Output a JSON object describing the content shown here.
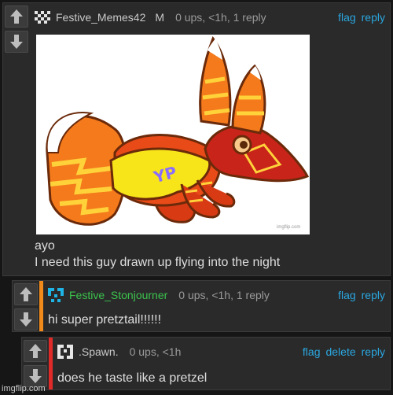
{
  "comments": [
    {
      "username": "Festive_Memes42",
      "mod_badge": "M",
      "meta": "0 ups, <1h, 1 reply",
      "actions": [
        "flag",
        "reply"
      ],
      "text_lines": [
        "ayo",
        "I need this guy drawn up flying into the night"
      ],
      "avatar_icon": "pixel-avatar-icon",
      "image_watermark": "imgflip.com"
    },
    {
      "username": "Festive_Stonjourner",
      "username_color": "#3bc24d",
      "accent_color": "#f08a1a",
      "meta": "0 ups, <1h, 1 reply",
      "actions": [
        "flag",
        "reply"
      ],
      "text": "hi super pretztail!!!!!!",
      "avatar_icon": "pixel-avatar-blue-icon"
    },
    {
      "username": ".Spawn.",
      "accent_color": "#e02a2a",
      "meta": "0 ups, <1h",
      "actions": [
        "flag",
        "delete",
        "reply"
      ],
      "text": "does he taste like a pretzel",
      "avatar_icon": "pixel-avatar-bracket-icon"
    }
  ],
  "vote_icons": {
    "up": "up-arrow-icon",
    "down": "down-arrow-icon"
  },
  "colors": {
    "link": "#2aa7e0",
    "background": "#161616",
    "panel": "#2a2a2a"
  },
  "footer_watermark": "imgflip.com"
}
